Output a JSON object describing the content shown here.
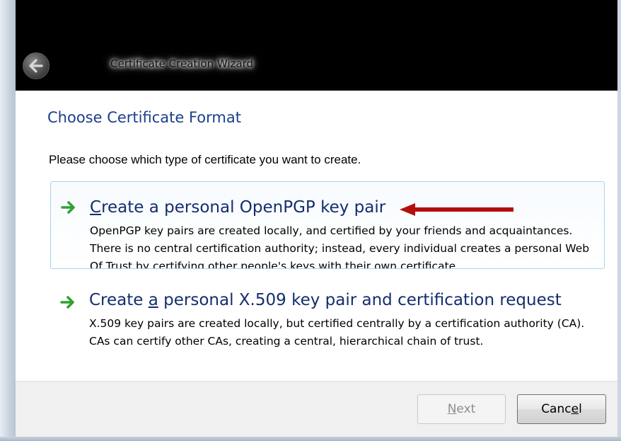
{
  "window": {
    "title": "Certificate Creation Wizard"
  },
  "page": {
    "heading": "Choose Certificate Format",
    "instruction": "Please choose which type of certificate you want to create."
  },
  "options": [
    {
      "title_pre": "",
      "title_mnemonic": "C",
      "title_post": "reate a personal OpenPGP key pair",
      "description": "OpenPGP key pairs are created locally, and certified by your friends and acquaintances. There is no central certification authority; instead, every individual creates a personal Web Of Trust by certifying other people's keys with their own certificate.",
      "selected": true
    },
    {
      "title_pre": "Create ",
      "title_mnemonic": "a",
      "title_post": " personal X.509 key pair and certification request",
      "description": "X.509 key pairs are created locally, but certified centrally by a certification authority (CA). CAs can certify other CAs, creating a central, hierarchical chain of trust.",
      "selected": false
    }
  ],
  "buttons": {
    "next_mnemonic": "N",
    "next_rest": "ext",
    "next_enabled": false,
    "cancel_pre": "Canc",
    "cancel_mnemonic": "e",
    "cancel_post": "l"
  },
  "colors": {
    "heading": "#1b3f8b",
    "option_title": "#142d6e",
    "option_arrow": "#2fa12f",
    "annotation_arrow": "#b40f0f",
    "selection_border": "#a9d4ef",
    "titlebar": "#000000"
  },
  "icons": {
    "back": "back-arrow-icon",
    "option": "green-arrow-icon",
    "annotation": "red-annotation-arrow"
  }
}
